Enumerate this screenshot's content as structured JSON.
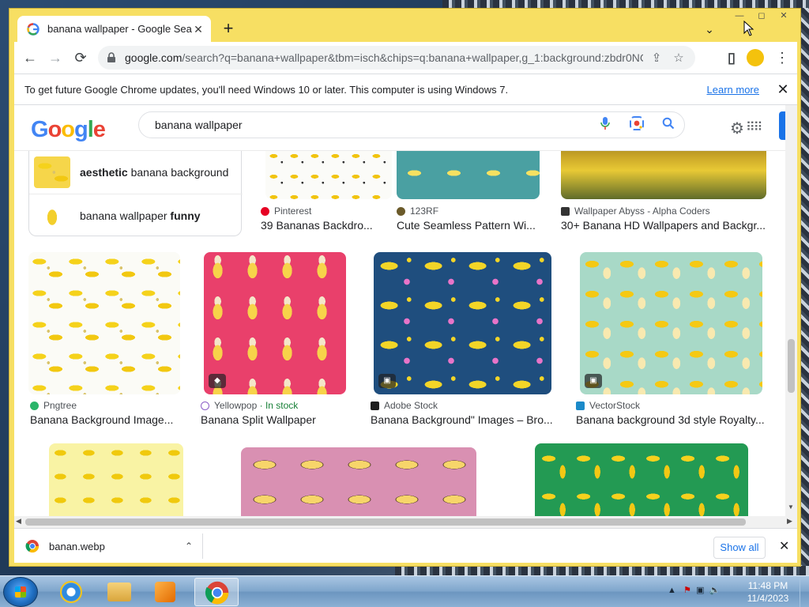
{
  "tab": {
    "title": "banana wallpaper - Google Search",
    "close_glyph": "✕"
  },
  "window_controls": {
    "minimize": "—",
    "maximize": "◻",
    "close": "✕"
  },
  "toolbar": {
    "back": "←",
    "forward": "→",
    "reload": "⟳",
    "url_host": "google.com",
    "url_rest": "/search?q=banana+wallpaper&tbm=isch&chips=q:banana+wallpaper,g_1:background:zbdr0NC...",
    "share": "⇪",
    "bookmark": "☆",
    "sidepanel": "▯",
    "menu": "⋮"
  },
  "infobar": {
    "text": "To get future Google Chrome updates, you'll need Windows 10 or later. This computer is using Windows 7.",
    "link": "Learn more",
    "close": "✕"
  },
  "google": {
    "logo": [
      "G",
      "o",
      "o",
      "g",
      "l",
      "e"
    ],
    "logo_colors": [
      "#4285f4",
      "#ea4335",
      "#fbbc05",
      "#4285f4",
      "#34a853",
      "#ea4335"
    ],
    "query": "banana wallpaper"
  },
  "related": [
    {
      "bold": "aesthetic",
      "rest": " banana background"
    },
    {
      "plain": "banana wallpaper ",
      "bold": "funny"
    }
  ],
  "row1": [
    {
      "source": "Pinterest",
      "title": "39 Bananas Backdro...",
      "fav_color": "#e60023"
    },
    {
      "source": "123RF",
      "title": "Cute Seamless Pattern Wi...",
      "fav_color": "#6b5a2a"
    },
    {
      "source": "Wallpaper Abyss - Alpha Coders",
      "title": "30+ Banana HD Wallpapers and Backgr...",
      "fav_color": "#333333"
    }
  ],
  "row2": [
    {
      "source": "Pngtree",
      "title": "Banana Background Image...",
      "fav_color": "#2ab56a"
    },
    {
      "source": "Yellowpop",
      "stock": "· In stock",
      "title": "Banana Split Wallpaper",
      "fav_color": "#8a5cc7"
    },
    {
      "source": "Adobe Stock",
      "title": "Banana Background\" Images – Bro...",
      "fav_color": "#1e1e1e"
    },
    {
      "source": "VectorStock",
      "title": "Banana background 3d style Royalty...",
      "fav_color": "#1b8ac9"
    }
  ],
  "downloads": {
    "file": "banan.webp",
    "chevron": "⌃",
    "show_all": "Show all",
    "close": "✕"
  },
  "clock": {
    "time": "11:48 PM",
    "date": "11/4/2023"
  }
}
